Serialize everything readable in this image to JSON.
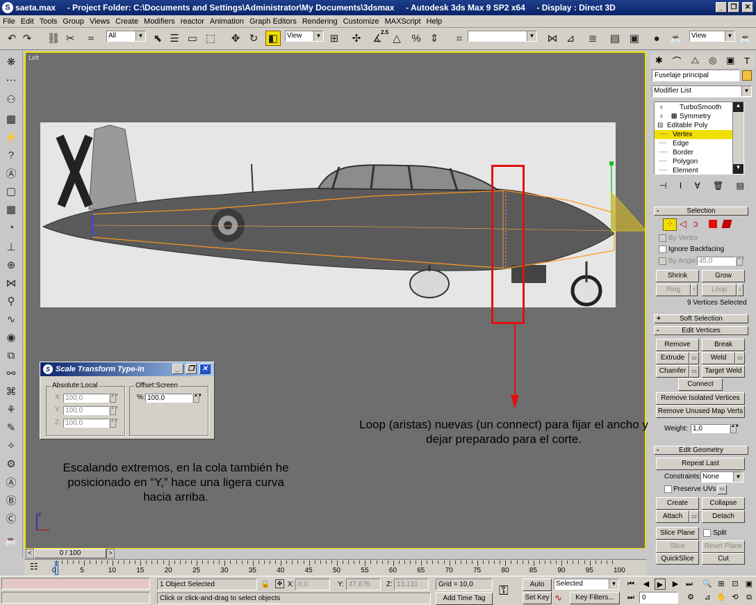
{
  "window": {
    "title": "saeta.max     - Project Folder: C:\\Documents and Settings\\Administrator\\My Documents\\3dsmax     - Autodesk 3ds Max 9 SP2 x64     - Display : Direct 3D",
    "minimize_icon": "minimize-icon",
    "maximize_icon": "maximize-icon",
    "close_icon": "close-icon"
  },
  "menu": [
    "File",
    "Edit",
    "Tools",
    "Group",
    "Views",
    "Create",
    "Modifiers",
    "reactor",
    "Animation",
    "Graph Editors",
    "Rendering",
    "Customize",
    "MAXScript",
    "Help"
  ],
  "toolbar": {
    "selection_filter": "All",
    "reference_coord": "View",
    "snap_value": "2.5",
    "named_selection": "",
    "render_view": "View"
  },
  "viewport": {
    "label": "Left",
    "annotation_right": "Loop  (aristas) nuevas (un connect) para fijar el ancho y dejar preparado para el corte.",
    "annotation_left": "Escalando extremos, en la cola también he posicionado en “Y,” hace una ligera curva hacia arriba.",
    "highlight_color": "#e01010",
    "border_color": "#f0e000"
  },
  "scale_dialog": {
    "title": "Scale Transform Type-In",
    "absolute_label": "Absolute:Local",
    "offset_label": "Offset:Screen",
    "x_label": "X:",
    "y_label": "Y:",
    "z_label": "Z:",
    "x": "100,0",
    "y": "100,0",
    "z": "100,0",
    "pct_label": "%:",
    "pct": "100,0"
  },
  "command_panel": {
    "object_name": "Fuselaje principal",
    "object_color": "#f0c040",
    "modifier_list": "Modifier List",
    "stack": [
      "TurboSmooth",
      "Symmetry",
      "Editable Poly",
      "Vertex",
      "Edge",
      "Border",
      "Polygon",
      "Element"
    ],
    "selection": {
      "title": "Selection",
      "by_vertex": "By Vertex",
      "ignore_backfacing": "Ignore Backfacing",
      "by_angle": "By Angle:",
      "angle_value": "45,0",
      "shrink": "Shrink",
      "grow": "Grow",
      "ring": "Ring",
      "loop": "Loop",
      "status": "9 Vertices Selected"
    },
    "soft_selection": "Soft Selection",
    "edit_vertices": {
      "title": "Edit Vertices",
      "remove": "Remove",
      "break": "Break",
      "extrude": "Extrude",
      "weld": "Weld",
      "chamfer": "Chamfer",
      "target_weld": "Target Weld",
      "connect": "Connect",
      "remove_isolated": "Remove Isolated Vertices",
      "remove_unused": "Remove Unused Map Verts",
      "weight_label": "Weight:",
      "weight": "1,0"
    },
    "edit_geometry": {
      "title": "Edit Geometry",
      "repeat_last": "Repeat Last",
      "constraints_label": "Constraints:",
      "constraints": "None",
      "preserve_uvs": "Preserve UVs",
      "create": "Create",
      "collapse": "Collapse",
      "attach": "Attach",
      "detach": "Detach",
      "slice_plane": "Slice Plane",
      "split": "Split",
      "slice": "Slice",
      "reset_plane": "Reset Plane",
      "quickslice": "QuickSlice",
      "cut": "Cut"
    }
  },
  "timeline": {
    "frame": "0 / 100",
    "ticks": [
      "0",
      "5",
      "10",
      "15",
      "20",
      "25",
      "30",
      "35",
      "40",
      "45",
      "50",
      "55",
      "60",
      "65",
      "70",
      "75",
      "80",
      "85",
      "90",
      "95",
      "100"
    ]
  },
  "status": {
    "selected": "1 Object Selected",
    "prompt": "Click or click-and-drag to select objects",
    "x_label": "X:",
    "x": "0,0",
    "y_label": "Y:",
    "y": "47,676",
    "z_label": "Z:",
    "z": "13,131",
    "grid": "Grid = 10,0",
    "add_time_tag": "Add Time Tag",
    "auto_key": "Auto Key",
    "set_key": "Set Key",
    "key_mode": "Selected",
    "key_filters": "Key Filters...",
    "current_frame": "0"
  }
}
